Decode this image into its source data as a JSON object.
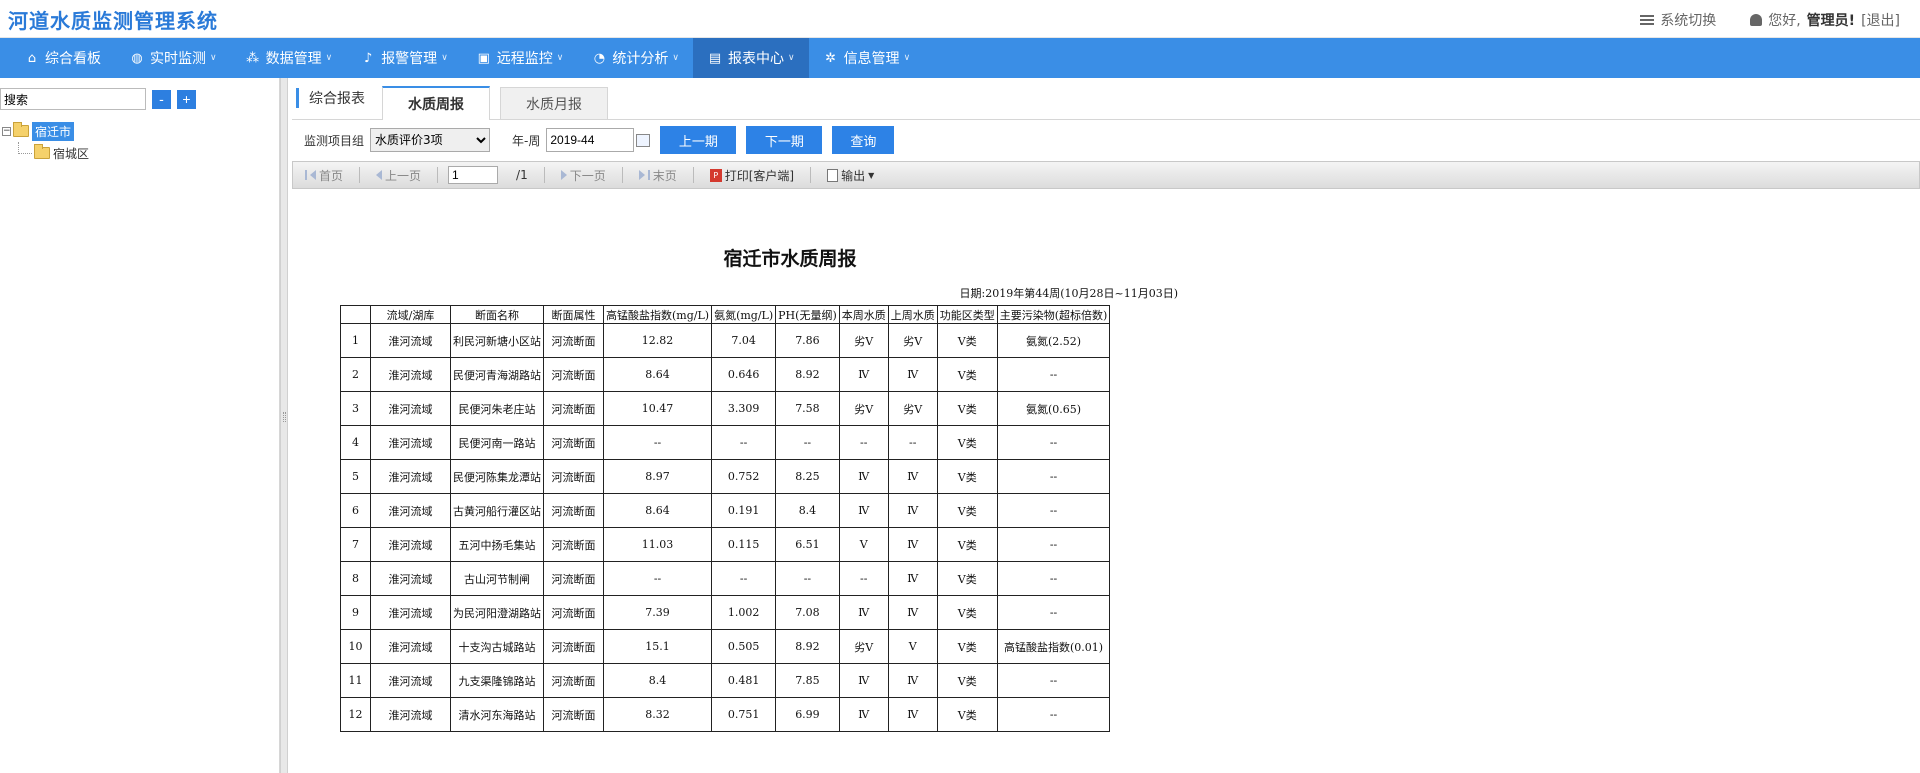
{
  "app": {
    "title": "河道水质监测管理系统",
    "switch_label": "系统切换",
    "greeting": "您好,",
    "user": "管理员!",
    "logout": "[退出]"
  },
  "nav": [
    {
      "label": "综合看板",
      "icon": "home-icon",
      "caret": false
    },
    {
      "label": "实时监测",
      "icon": "globe-icon",
      "caret": true
    },
    {
      "label": "数据管理",
      "icon": "nodes-icon",
      "caret": true
    },
    {
      "label": "报警管理",
      "icon": "bell-icon",
      "caret": true
    },
    {
      "label": "远程监控",
      "icon": "monitor-icon",
      "caret": true
    },
    {
      "label": "统计分析",
      "icon": "pie-chart-icon",
      "caret": true
    },
    {
      "label": "报表中心",
      "icon": "report-icon",
      "caret": true
    },
    {
      "label": "信息管理",
      "icon": "gear-icon",
      "caret": true
    }
  ],
  "sidebar": {
    "search_placeholder": "搜索",
    "search_value": "搜索",
    "collapse_label": "-",
    "expand_label": "+",
    "tree": [
      {
        "label": "宿迁市",
        "selected": true
      },
      {
        "label": "宿城区",
        "selected": false
      }
    ]
  },
  "tabs": {
    "title": "综合报表",
    "items": [
      "水质周报",
      "水质月报"
    ]
  },
  "filters": {
    "group_label": "监测项目组",
    "group_value": "水质评价3项",
    "week_label": "年-周",
    "week_value": "2019-44",
    "prev": "上一期",
    "next": "下一期",
    "query": "查询"
  },
  "toolbar": {
    "first": "首页",
    "prev": "上一页",
    "page": "1",
    "total": "/1",
    "next": "下一页",
    "last": "末页",
    "print": "打印[客户端]",
    "export": "输出"
  },
  "report": {
    "title": "宿迁市水质周报",
    "date": "日期:2019年第44周(10月28日~11月03日)",
    "headers": [
      "",
      "流域/湖库",
      "断面名称",
      "断面属性",
      "高锰酸盐指数(mg/L)",
      "氨氮(mg/L)",
      "PH(无量纲)",
      "本周水质",
      "上周水质",
      "功能区类型",
      "主要污染物(超标倍数)"
    ],
    "rows": [
      [
        "1",
        "淮河流域",
        "利民河新塘小区站",
        "河流断面",
        "12.82",
        "7.04",
        "7.86",
        "劣Ⅴ",
        "劣Ⅴ",
        "Ⅴ类",
        "氨氮(2.52)"
      ],
      [
        "2",
        "淮河流域",
        "民便河青海湖路站",
        "河流断面",
        "8.64",
        "0.646",
        "8.92",
        "Ⅳ",
        "Ⅳ",
        "Ⅴ类",
        "--"
      ],
      [
        "3",
        "淮河流域",
        "民便河朱老庄站",
        "河流断面",
        "10.47",
        "3.309",
        "7.58",
        "劣Ⅴ",
        "劣Ⅴ",
        "Ⅴ类",
        "氨氮(0.65)"
      ],
      [
        "4",
        "淮河流域",
        "民便河南一路站",
        "河流断面",
        "--",
        "--",
        "--",
        "--",
        "--",
        "Ⅴ类",
        "--"
      ],
      [
        "5",
        "淮河流域",
        "民便河陈集龙潭站",
        "河流断面",
        "8.97",
        "0.752",
        "8.25",
        "Ⅳ",
        "Ⅳ",
        "Ⅴ类",
        "--"
      ],
      [
        "6",
        "淮河流域",
        "古黄河船行灌区站",
        "河流断面",
        "8.64",
        "0.191",
        "8.4",
        "Ⅳ",
        "Ⅳ",
        "Ⅴ类",
        "--"
      ],
      [
        "7",
        "淮河流域",
        "五河中扬毛集站",
        "河流断面",
        "11.03",
        "0.115",
        "6.51",
        "Ⅴ",
        "Ⅳ",
        "Ⅴ类",
        "--"
      ],
      [
        "8",
        "淮河流域",
        "古山河节制闸",
        "河流断面",
        "--",
        "--",
        "--",
        "--",
        "Ⅳ",
        "Ⅴ类",
        "--"
      ],
      [
        "9",
        "淮河流域",
        "为民河阳澄湖路站",
        "河流断面",
        "7.39",
        "1.002",
        "7.08",
        "Ⅳ",
        "Ⅳ",
        "Ⅴ类",
        "--"
      ],
      [
        "10",
        "淮河流域",
        "十支沟古城路站",
        "河流断面",
        "15.1",
        "0.505",
        "8.92",
        "劣Ⅴ",
        "Ⅴ",
        "Ⅴ类",
        "高锰酸盐指数(0.01)"
      ],
      [
        "11",
        "淮河流域",
        "九支渠隆锦路站",
        "河流断面",
        "8.4",
        "0.481",
        "7.85",
        "Ⅳ",
        "Ⅳ",
        "Ⅴ类",
        "--"
      ],
      [
        "12",
        "淮河流域",
        "清水河东海路站",
        "河流断面",
        "8.32",
        "0.751",
        "6.99",
        "Ⅳ",
        "Ⅳ",
        "Ⅴ类",
        "--"
      ]
    ]
  },
  "colors": {
    "nav_bg": "#3a8ee6",
    "nav_active": "#2b6fbf",
    "brand": "#2a7ad8",
    "button": "#2d82e6"
  }
}
